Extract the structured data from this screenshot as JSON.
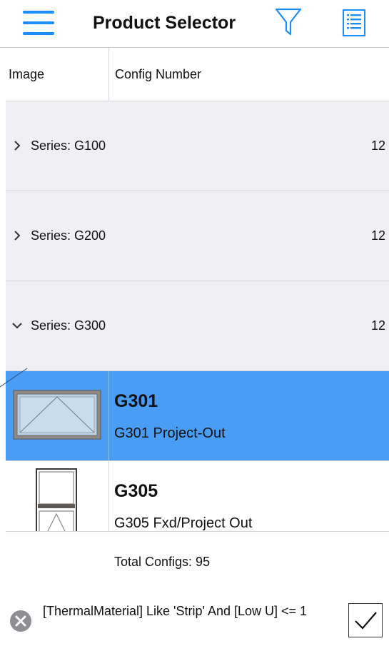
{
  "header": {
    "title": "Product Selector",
    "menu_icon": "hamburger-menu-icon",
    "filter_icon": "funnel-filter-icon",
    "list_icon": "list-document-icon",
    "accent_color": "#1e8ef7"
  },
  "columns": {
    "image": "Image",
    "config_number": "Config Number"
  },
  "groups": [
    {
      "label": "Series: G100",
      "count": "12",
      "expanded": false
    },
    {
      "label": "Series: G200",
      "count": "12",
      "expanded": false
    },
    {
      "label": "Series: G300",
      "count": "12",
      "expanded": true
    }
  ],
  "items": [
    {
      "code": "G301",
      "description": "G301 Project-Out",
      "selected": true
    },
    {
      "code": "G305",
      "description": "G305 Fxd/Project Out",
      "selected": false
    }
  ],
  "footer": {
    "total": "Total Configs: 95"
  },
  "filter": {
    "expression": "[ThermalMaterial] Like 'Strip' And [Low U] <= 1",
    "clear_icon": "clear-circle-x-icon",
    "apply_icon": "checkmark-icon"
  },
  "colors": {
    "selected_row": "#4a9df5",
    "group_row": "#efeff4"
  }
}
